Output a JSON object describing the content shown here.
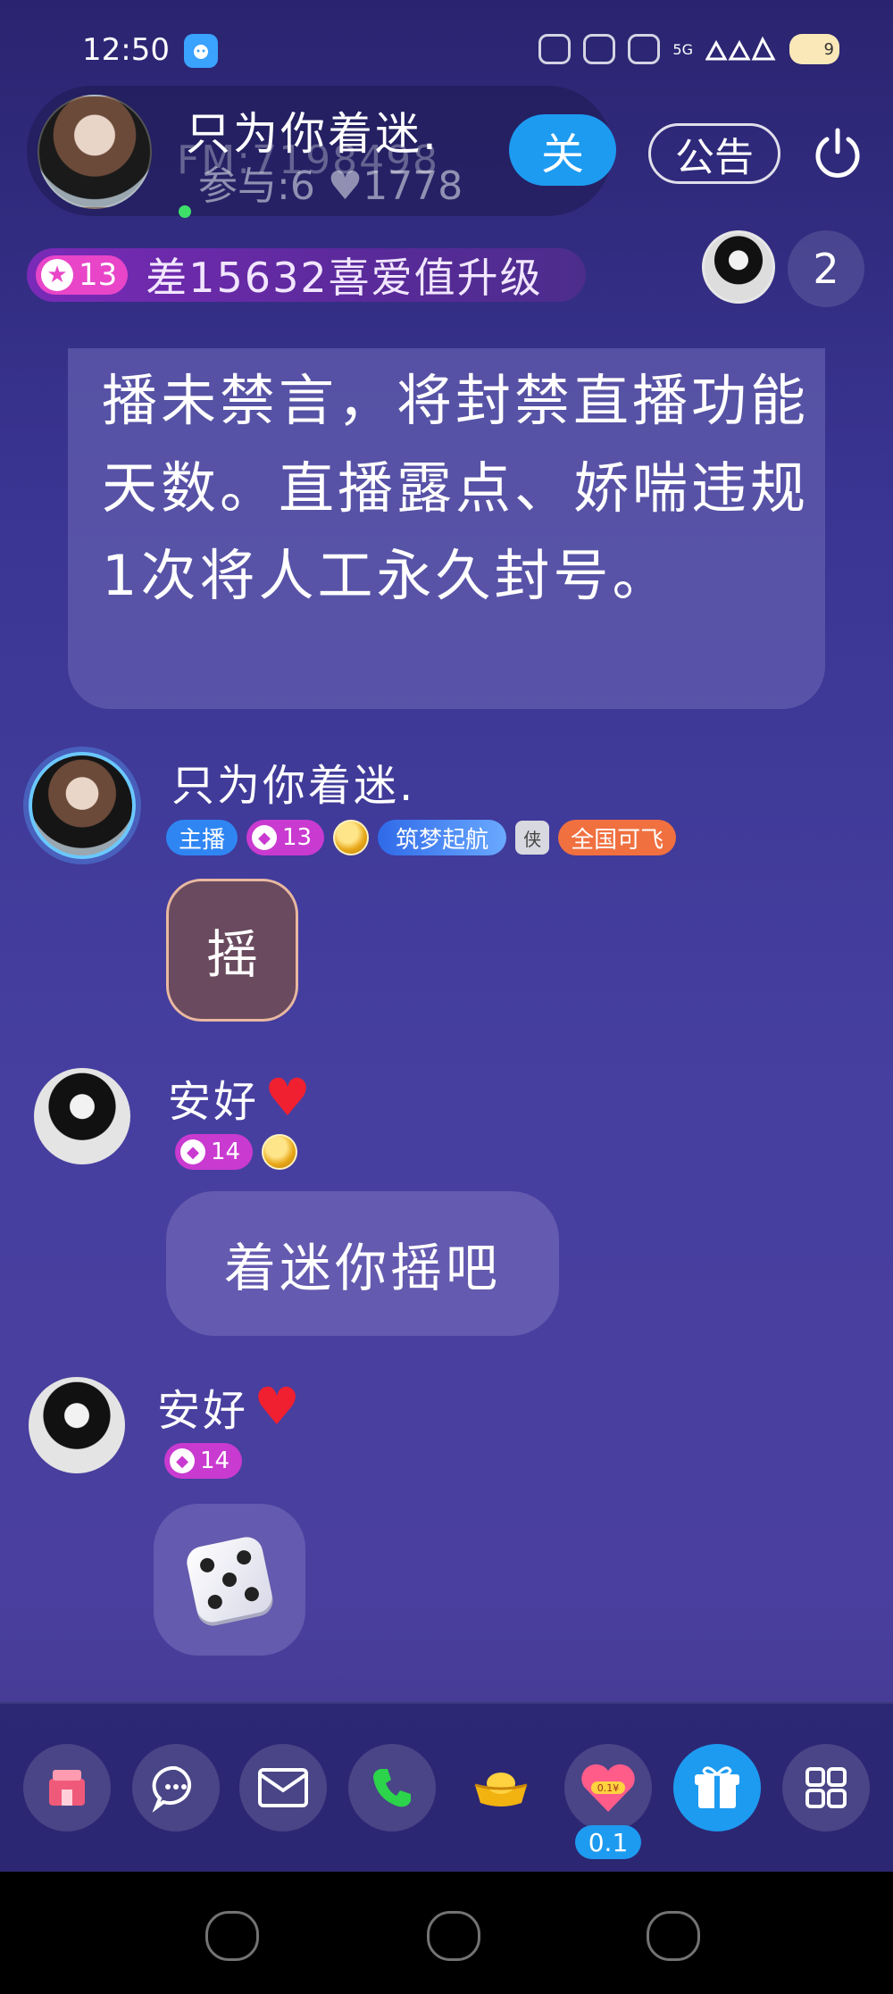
{
  "status_bar": {
    "time": "12:50",
    "network": "5G",
    "battery": "9"
  },
  "room": {
    "title": "只为你着迷.",
    "id_text": "FM:7198498",
    "stats": "参与:6 ♥1778",
    "follow_label": "关",
    "notice_label": "公告"
  },
  "level_bar": {
    "level": "13",
    "text": "差15632喜爱值升级"
  },
  "viewers": {
    "count": "2"
  },
  "system_notice": {
    "text": "播未禁言，将封禁直播功能天数。直播露点、娇喘违规1次将人工永久封号。"
  },
  "messages": [
    {
      "name": "只为你着迷.",
      "badges": {
        "host": "主播",
        "level": "13",
        "dream": "筑梦起航",
        "knight": "侠",
        "fly": "全国可飞"
      },
      "content": "摇"
    },
    {
      "name": "安好",
      "badges": {
        "level": "14"
      },
      "content": "着迷你摇吧"
    },
    {
      "name": "安好",
      "badges": {
        "level": "14"
      },
      "content_icon": "dice-icon"
    }
  ],
  "toolbar": {
    "heart_value": "0.1",
    "heart_badge": "0.1¥",
    "items": [
      "store-icon",
      "chat-icon",
      "mail-icon",
      "phone-icon",
      "gold-ingot-icon",
      "heart-gift-icon",
      "gift-icon",
      "grid-menu-icon"
    ]
  },
  "colors": {
    "accent_blue": "#1d9bf0",
    "level_pink": "#c93ad0",
    "heart_red": "#f02030",
    "fly_orange": "#f07040"
  }
}
